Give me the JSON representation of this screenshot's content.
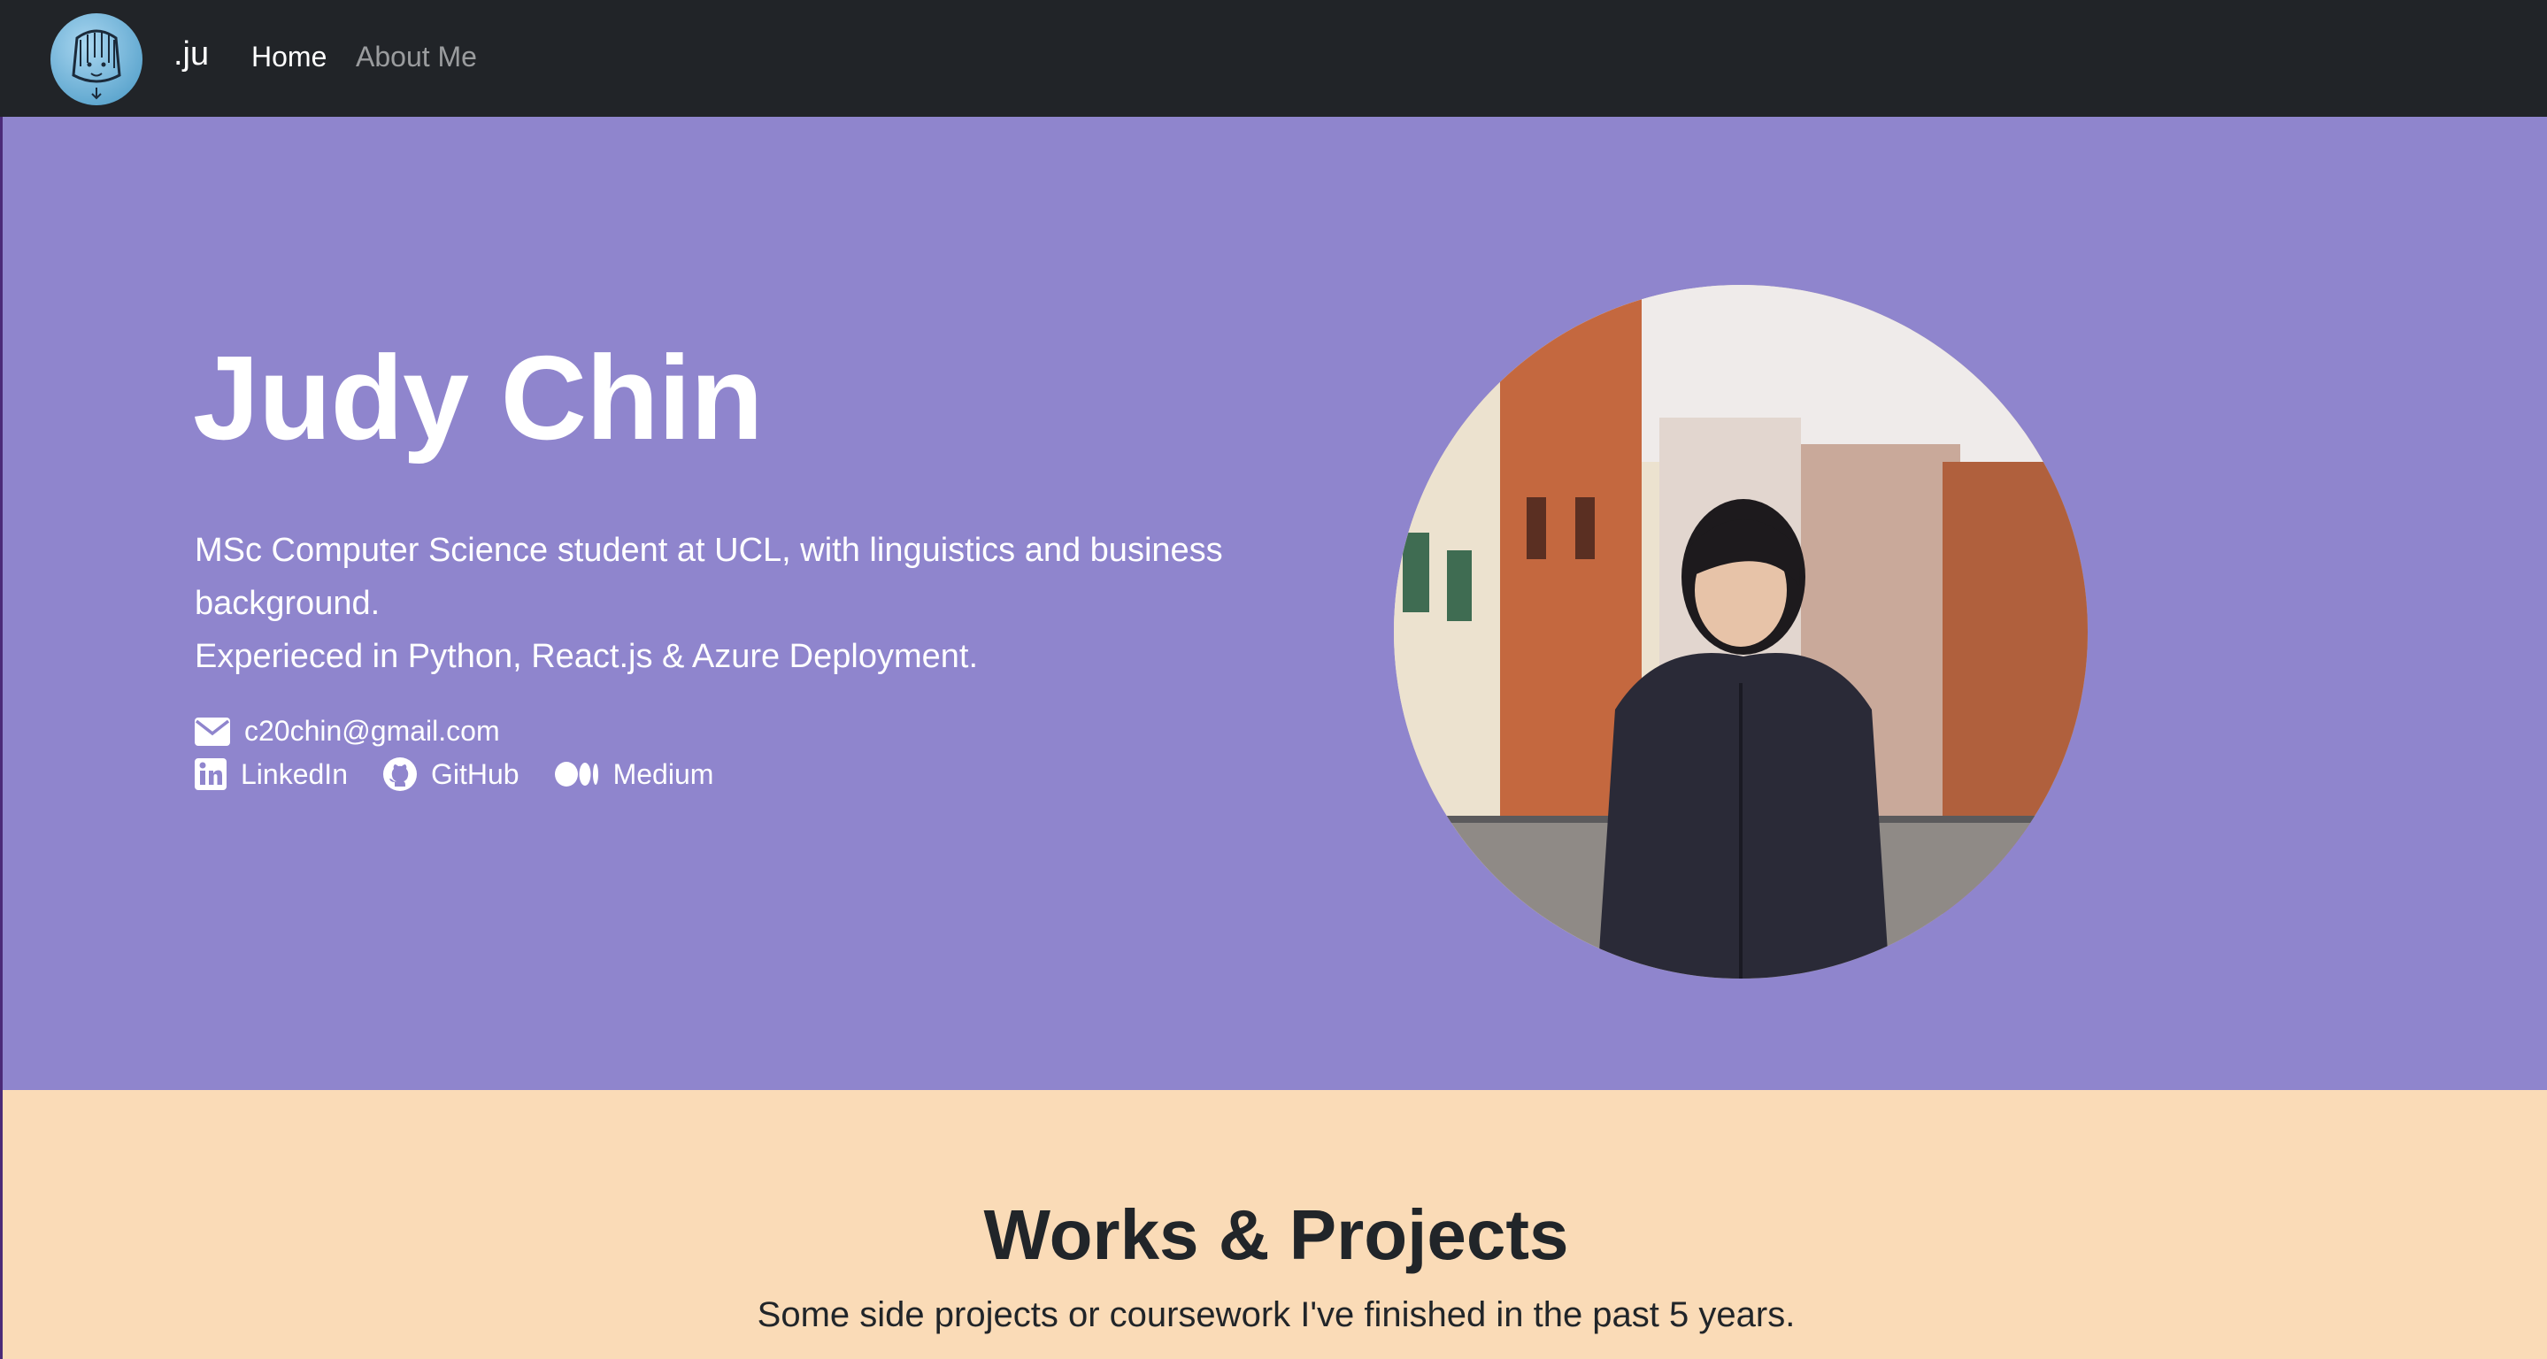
{
  "navbar": {
    "brand_text": ".ju",
    "links": [
      {
        "label": "Home",
        "active": true
      },
      {
        "label": "About Me",
        "active": false
      }
    ]
  },
  "hero": {
    "name": "Judy Chin",
    "description_line1": "MSc Computer Science student at UCL, with linguistics and business background.",
    "description_line2": "Experieced in Python, React.js & Azure Deployment.",
    "email": "c20chin@gmail.com",
    "links": {
      "linkedin": "LinkedIn",
      "github": "GitHub",
      "medium": "Medium"
    }
  },
  "works": {
    "title": "Works & Projects",
    "subtitle": "Some side projects or coursework I've finished in the past 5 years."
  },
  "colors": {
    "navbar_bg": "#212428",
    "hero_bg": "#8f85cd",
    "works_bg": "#fadbb7",
    "text_dark": "#212529"
  },
  "icons": [
    "envelope-icon",
    "linkedin-icon",
    "github-icon",
    "medium-icon"
  ]
}
